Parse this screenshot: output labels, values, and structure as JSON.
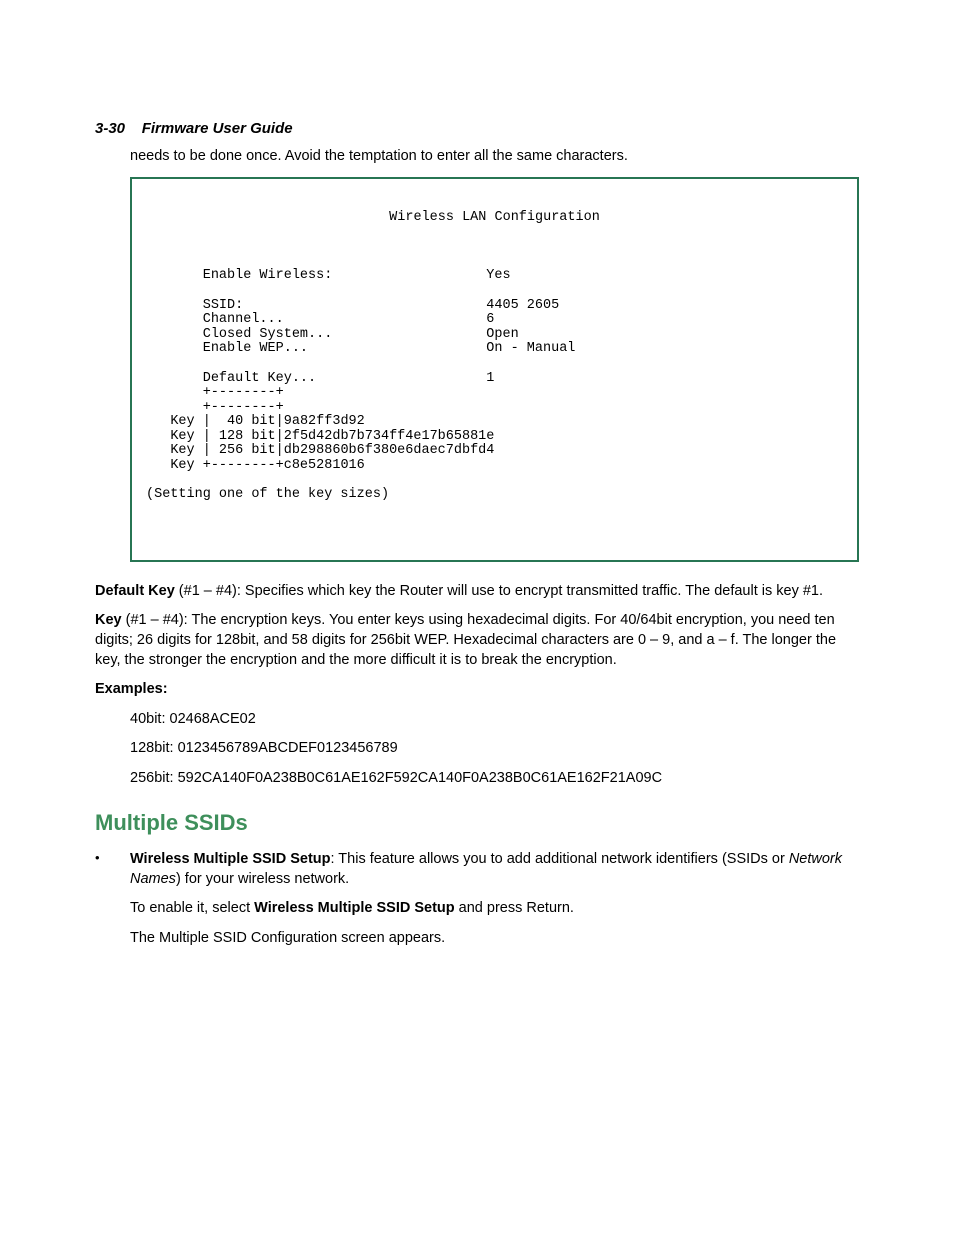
{
  "header": {
    "page_label": "3-30",
    "doc_title": "Firmware User Guide"
  },
  "intro_tail": "needs to be done once. Avoid the temptation to enter all the same characters.",
  "terminal": {
    "title": "Wireless LAN Configuration",
    "rows": {
      "enable_wireless": {
        "label": "Enable Wireless:",
        "value": "Yes"
      },
      "ssid": {
        "label": "SSID:",
        "value": "4405 2605"
      },
      "channel": {
        "label": "Channel...",
        "value": "6"
      },
      "closed_system": {
        "label": "Closed System...",
        "value": "Open"
      },
      "enable_wep": {
        "label": "Enable WEP...",
        "value": "On - Manual"
      },
      "default_key": {
        "label": "Default Key...",
        "value": "1"
      }
    },
    "key_table": {
      "k1": {
        "prefix": "Key |",
        "bits": "  40 bit",
        "val": "9a82ff3d92"
      },
      "k2": {
        "prefix": "Key |",
        "bits": " 128 bit",
        "val": "2f5d42db7b734ff4e17b65881e"
      },
      "k3": {
        "prefix": "Key |",
        "bits": " 256 bit",
        "val": "db298860b6f380e6daec7dbfd4"
      },
      "k4": {
        "prefix": "Key +--------+",
        "val": "c8e5281016"
      }
    },
    "footer": "(Setting one of the key sizes)"
  },
  "default_key_para": {
    "bold": "Default Key",
    "rest": " (#1 – #4): Specifies which key the Router will use to encrypt transmitted traffic. The default is key #1."
  },
  "key_para": {
    "bold": "Key",
    "rest": " (#1 – #4): The encryption keys. You enter keys using hexadecimal digits. For 40/64bit encryption, you need ten digits; 26 digits for 128bit, and 58 digits for 256bit WEP. Hexadecimal characters are 0 – 9, and a – f. The longer the key, the stronger the encryption and the more difficult it is to break the encryption."
  },
  "examples": {
    "heading": "Examples:",
    "e40": "40bit: 02468ACE02",
    "e128": "128bit: 0123456789ABCDEF0123456789",
    "e256": "256bit: 592CA140F0A238B0C61AE162F592CA140F0A238B0C61AE162F21A09C"
  },
  "section": {
    "title": "Multiple SSIDs",
    "bullet": {
      "lead_bold": "Wireless Multiple SSID Setup",
      "lead_rest": ": This feature allows you to add additional network identifiers (SSIDs or ",
      "italic": "Network Names",
      "tail": ") for your wireless network."
    },
    "p2a": "To enable it, select ",
    "p2b_bold": "Wireless Multiple SSID Setup",
    "p2c": " and press Return.",
    "p3": "The Multiple SSID Configuration screen appears."
  }
}
